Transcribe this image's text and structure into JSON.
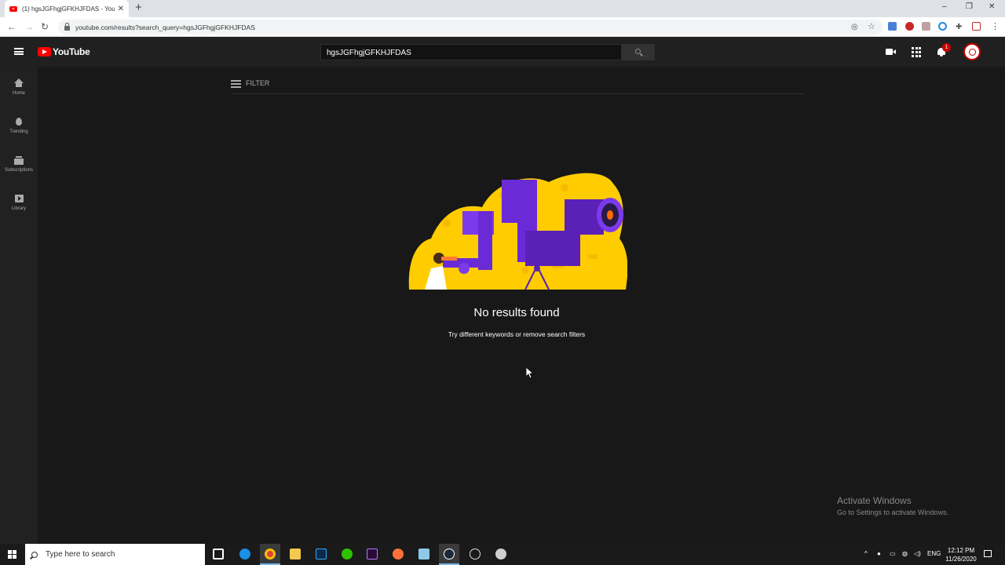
{
  "browser": {
    "tab_title": "(1) hgsJGFhgjGFKHJFDAS - YouTu",
    "new_tab_label": "+",
    "url": "youtube.com/results?search_query=hgsJGFhgjGFKHJFDAS",
    "window_controls": {
      "minimize": "–",
      "restore": "❐",
      "close": "✕"
    }
  },
  "youtube": {
    "logo_text": "YouTube",
    "search_value": "hgsJGFhgjGFKHJFDAS",
    "notification_count": "1",
    "guide": [
      {
        "label": "Home",
        "icon": "home-icon"
      },
      {
        "label": "Trending",
        "icon": "trending-icon"
      },
      {
        "label": "Subscriptions",
        "icon": "subscriptions-icon"
      },
      {
        "label": "Library",
        "icon": "library-icon"
      }
    ],
    "filter_label": "FILTER",
    "empty_title": "No results found",
    "empty_subtitle": "Try different keywords or remove search filters"
  },
  "watermark": {
    "line1": "Activate Windows",
    "line2": "Go to Settings to activate Windows."
  },
  "taskbar": {
    "search_placeholder": "Type here to search",
    "lang": "ENG",
    "time": "12:12 PM",
    "date": "11/26/2020"
  },
  "colors": {
    "yt_red": "#ff0000",
    "yt_bg": "#181818",
    "illustration_yellow": "#ffcc00",
    "illustration_purple": "#6a2bd6"
  }
}
